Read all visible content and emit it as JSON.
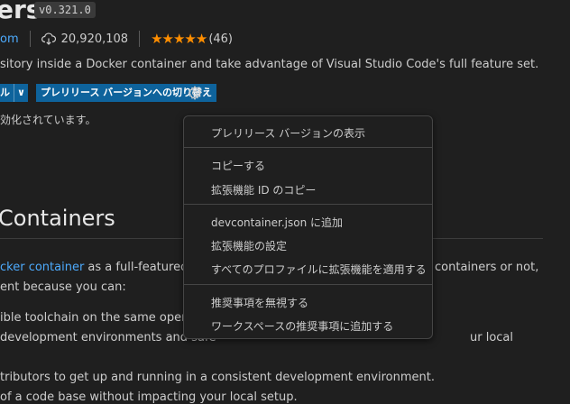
{
  "header": {
    "title": "ers",
    "version": "v0.321.0",
    "publisher_link": "om",
    "installs": "20,920,108",
    "stars": "★★★★★",
    "rating_count": "(46)",
    "description": "sitory inside a Docker container and take advantage of Visual Studio Code's full feature set."
  },
  "actions": {
    "install_label_fragment": "ル",
    "dropdown_glyph": "∨",
    "prerelease_button": "プレリリース バージョンへの切り替え",
    "enabled_text": "効化されています。"
  },
  "readme": {
    "heading": "Containers",
    "line1_link": "cker container",
    "line1_text": " as a full-featured dev",
    "line1_right": "containers or not,",
    "line2": "ent because you can:",
    "line3": "ible toolchain on the same operatin",
    "line4_left": "development environments and safe",
    "line4_right": "ur local",
    "line5": "tributors to get up and running in a consistent development environment.",
    "line6": "of a code base without impacting your local setup."
  },
  "context_menu": {
    "items": [
      "プレリリース バージョンの表示",
      "コピーする",
      "拡張機能 ID のコピー",
      "devcontainer.json に追加",
      "拡張機能の設定",
      "すべてのプロファイルに拡張機能を適用する",
      "推奨事項を無視する",
      "ワークスペースの推奨事項に追加する"
    ]
  },
  "colors": {
    "background": "#1f1f1f",
    "accent": "#0e639c",
    "link": "#4daafc",
    "star": "#ff8e00"
  },
  "icons": [
    "cloud-download-icon",
    "gear-icon",
    "chevron-down-icon"
  ]
}
